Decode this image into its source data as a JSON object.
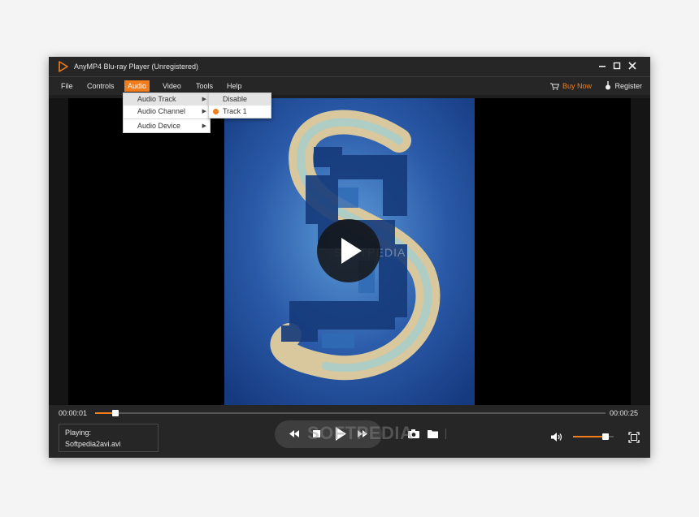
{
  "window": {
    "title": "AnyMP4 Blu-ray Player (Unregistered)"
  },
  "menubar": {
    "items": [
      {
        "label": "File"
      },
      {
        "label": "Controls"
      },
      {
        "label": "Audio",
        "active": true
      },
      {
        "label": "Video"
      },
      {
        "label": "Tools"
      },
      {
        "label": "Help"
      }
    ],
    "buy_now": "Buy Now",
    "register": "Register"
  },
  "audio_menu": {
    "items": [
      "Audio Track",
      "Audio Channel",
      "Audio Device"
    ]
  },
  "audio_track_submenu": {
    "items": [
      "Disable",
      "Track 1"
    ],
    "selected": "Track 1"
  },
  "playback": {
    "current_time": "00:00:01",
    "total_time": "00:00:25",
    "progress": 0.04,
    "volume": 0.8,
    "playing_label": "Playing:",
    "file_name": "Softpedia2avi.avi"
  },
  "watermark": "SOFTPEDIA",
  "colors": {
    "accent": "#f27d1c",
    "window_bg": "#1e1e1e",
    "bar_bg": "#262626"
  }
}
